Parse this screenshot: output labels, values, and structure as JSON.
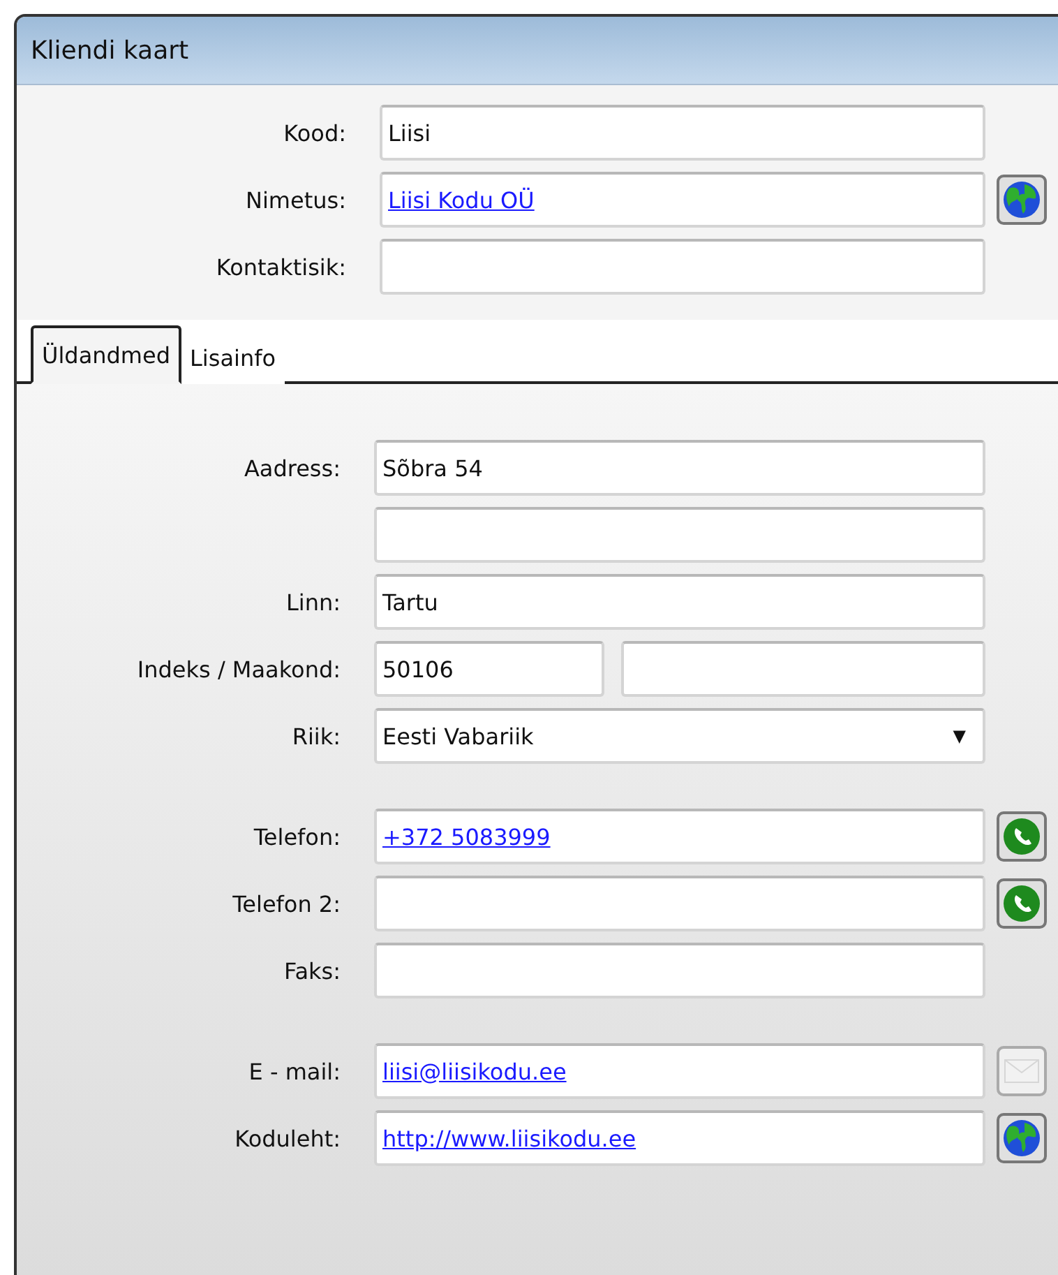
{
  "window": {
    "title": "Kliendi kaart"
  },
  "header_fields": [
    {
      "label": "Kood:",
      "kind": "text",
      "value": "Liisi"
    },
    {
      "label": "Nimetus:",
      "kind": "link",
      "value": "Liisi Kodu OÜ",
      "action": {
        "kind": "globe",
        "disabled": false
      }
    },
    {
      "label": "Kontaktisik:",
      "kind": "text"
    }
  ],
  "tabs": [
    {
      "label": "Üldandmed",
      "selected": true
    },
    {
      "label": "Lisainfo",
      "selected": false
    }
  ],
  "groups": [
    [
      {
        "label": "Aadress:",
        "kind": "text",
        "value": "Sõbra 54"
      },
      {
        "kind": "text"
      },
      {
        "label": "Linn:",
        "kind": "text",
        "value": "Tartu"
      },
      {
        "label": "Indeks / Maakond:",
        "kind": "split",
        "value": "50106"
      },
      {
        "label": "Riik:",
        "kind": "dropdown",
        "value": "Eesti Vabariik",
        "arrow": "▼"
      }
    ],
    [
      {
        "label": "Telefon:",
        "kind": "link",
        "value": "+372 5083999",
        "action": {
          "kind": "phone",
          "disabled": false
        }
      },
      {
        "label": "Telefon 2:",
        "kind": "text",
        "action": {
          "kind": "phone",
          "disabled": false
        }
      },
      {
        "label": "Faks:",
        "kind": "text"
      }
    ],
    [
      {
        "label": "E - mail:",
        "kind": "link",
        "value": "liisi@liisikodu.ee",
        "action": {
          "kind": "mail",
          "disabled": true
        }
      },
      {
        "label": "Koduleht:",
        "kind": "link",
        "value": "http://www.liisikodu.ee",
        "action": {
          "kind": "globe",
          "disabled": false
        }
      }
    ]
  ]
}
